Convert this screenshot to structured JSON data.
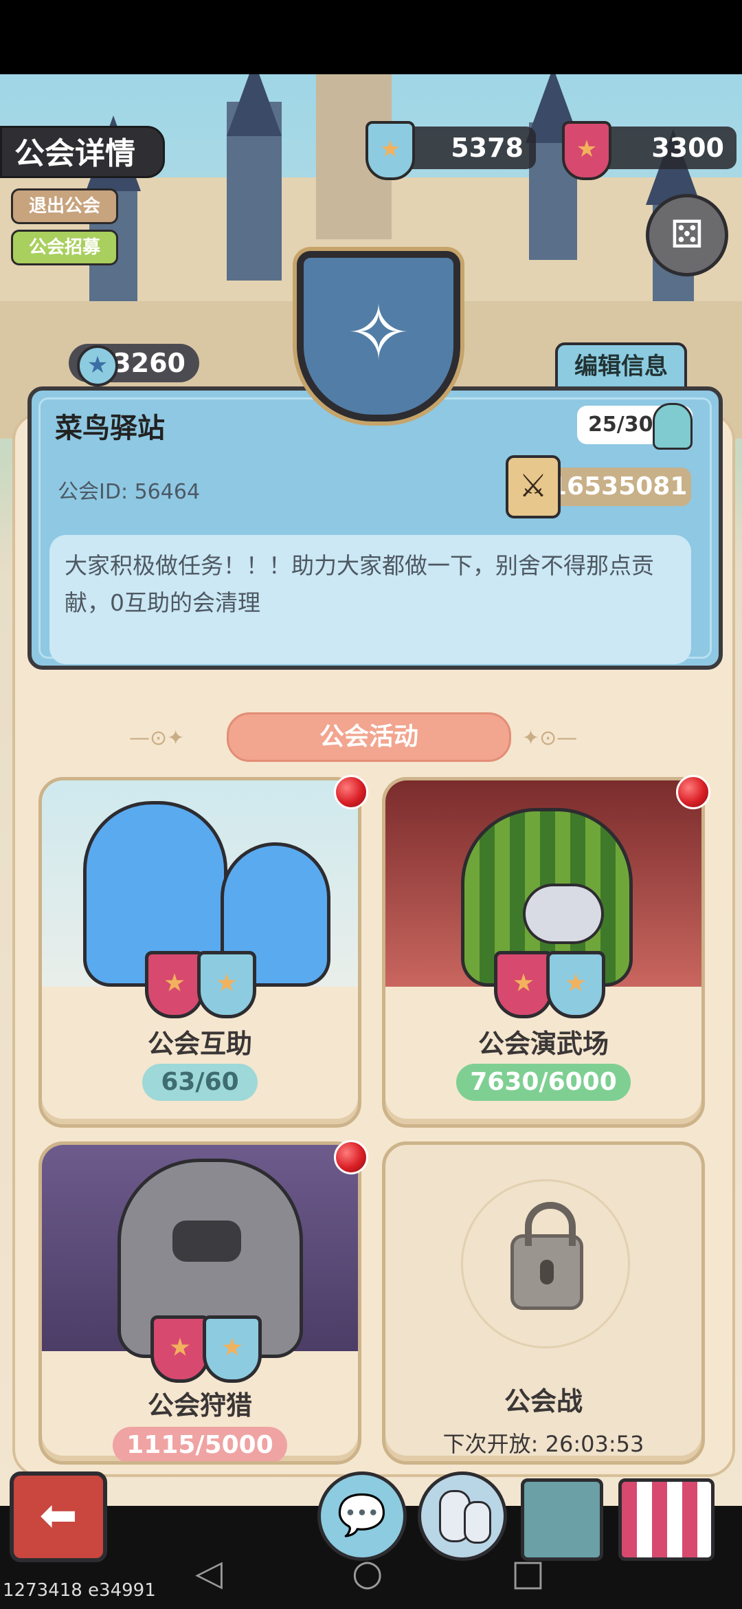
{
  "header": {
    "title": "公会详情",
    "quit_label": "退出公会",
    "recruit_label": "公会招募"
  },
  "currencies": {
    "blue_value": "5378",
    "red_value": "3300"
  },
  "guild": {
    "level": "3260",
    "edit_label": "编辑信息",
    "name": "菜鸟驿站",
    "members": "25/30",
    "id_text": "公会ID: 56464",
    "power": "16535081",
    "notice": "大家积极做任务！！！助力大家都做一下，别舍不得那点贡献，0互助的会清理"
  },
  "activities": {
    "section_title": "公会活动",
    "items": [
      {
        "label": "公会互助",
        "progress": "63/60"
      },
      {
        "label": "公会演武场",
        "progress": "7630/6000"
      },
      {
        "label": "公会狩猎",
        "progress": "1115/5000"
      },
      {
        "label": "公会战",
        "progress": "下次开放: 26:03:53"
      }
    ]
  },
  "footer": {
    "build_id": "1273418 e34991"
  },
  "colors": {
    "accent_blue": "#8fc8e2",
    "accent_red": "#d7496f",
    "progress_teal": "#9ed8d8",
    "progress_green": "#7fcf93",
    "progress_pink": "#efa3a3"
  },
  "icons": [
    "back-arrow-icon",
    "chat-icon",
    "members-icon",
    "book-icon",
    "shop-icon",
    "lock-icon",
    "dice-icon",
    "star-icon",
    "person-icon",
    "sword-icon"
  ]
}
